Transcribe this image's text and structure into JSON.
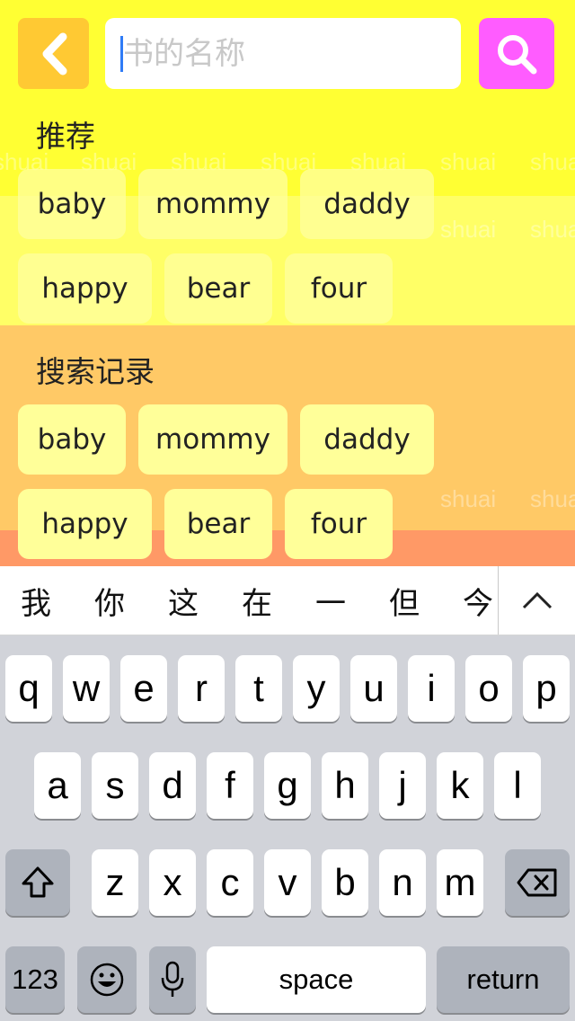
{
  "search": {
    "placeholder": "书的名称"
  },
  "watermark": "shuai",
  "recommended": {
    "title": "推荐",
    "tags": [
      "baby",
      "mommy",
      "daddy",
      "happy",
      "bear",
      "four"
    ]
  },
  "history": {
    "title": "搜索记录",
    "tags": [
      "baby",
      "mommy",
      "daddy",
      "happy",
      "bear",
      "four"
    ]
  },
  "suggestions": [
    "我",
    "你",
    "这",
    "在",
    "一",
    "但",
    "今"
  ],
  "keyboard": {
    "row1": [
      "q",
      "w",
      "e",
      "r",
      "t",
      "y",
      "u",
      "i",
      "o",
      "p"
    ],
    "row2": [
      "a",
      "s",
      "d",
      "f",
      "g",
      "h",
      "j",
      "k",
      "l"
    ],
    "row3": [
      "z",
      "x",
      "c",
      "v",
      "b",
      "n",
      "m"
    ],
    "numbers_label": "123",
    "space_label": "space",
    "return_label": "return"
  },
  "colors": {
    "back_button": "#ffc933",
    "search_button": "#ff5cff",
    "band_top": "#ffff33",
    "band_history": "#ffc966"
  }
}
